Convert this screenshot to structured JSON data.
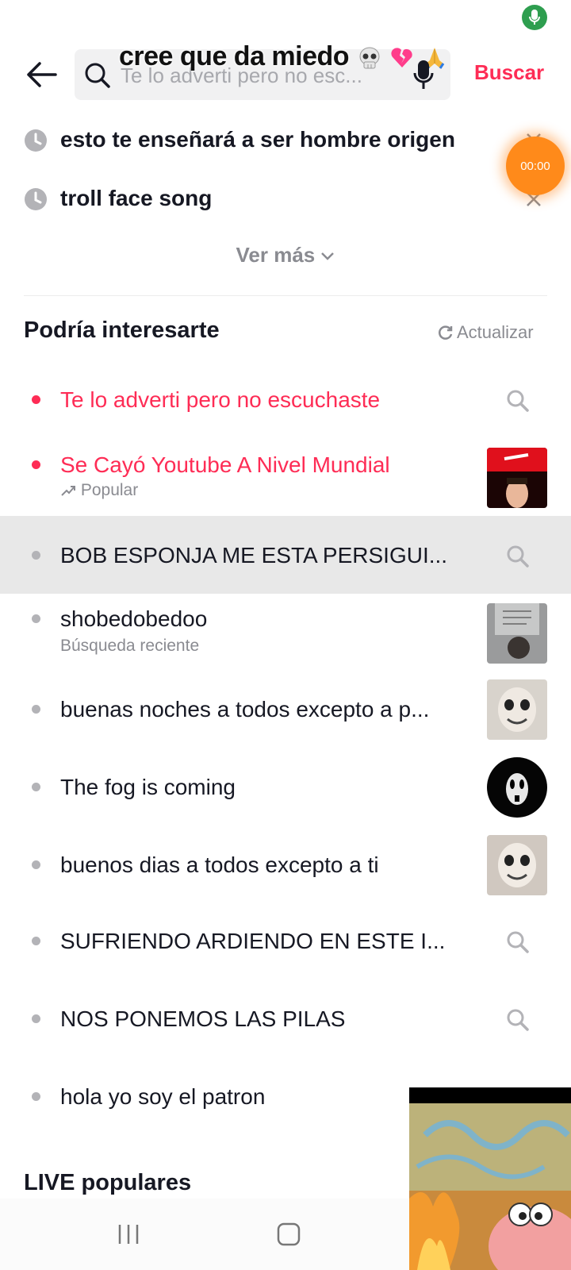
{
  "status": {
    "mic_icon": "mic-active-icon"
  },
  "header": {
    "back_icon": "arrow-left-icon",
    "search_placeholder": "Te lo adverti pero no esc...",
    "overlay_caption": "cree que da miedo",
    "search_button": "Buscar",
    "colors": {
      "accent": "#fe2c55"
    }
  },
  "history": [
    {
      "text": "esto te enseñará a ser hombre origen"
    },
    {
      "text": "troll face song"
    }
  ],
  "timer": "00:00",
  "see_more": "Ver más",
  "suggestions_section": {
    "title": "Podría interesarte",
    "refresh": "Actualizar",
    "items": [
      {
        "text": "Te lo adverti pero no escuchaste",
        "highlight": true
      },
      {
        "text": "Se Cayó Youtube A Nivel Mundial",
        "highlight": true,
        "sub": "Popular"
      },
      {
        "text": "BOB ESPONJA ME ESTA PERSIGUI..."
      },
      {
        "text": "shobedobedoo",
        "sub": "Búsqueda reciente"
      },
      {
        "text": "buenas noches a todos excepto a p..."
      },
      {
        "text": "The fog is coming"
      },
      {
        "text": "buenos dias a todos excepto a ti"
      },
      {
        "text": "SUFRIENDO ARDIENDO EN ESTE I..."
      },
      {
        "text": "NOS PONEMOS LAS PILAS"
      },
      {
        "text": "hola yo soy el patron"
      }
    ]
  },
  "live_section": {
    "title": "LIVE populares"
  }
}
